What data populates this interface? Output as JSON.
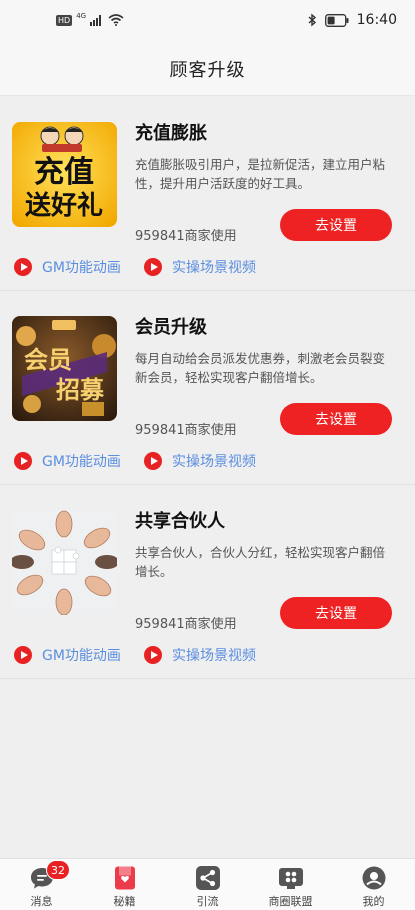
{
  "status_bar": {
    "hd": "HD",
    "network": "4G",
    "time": "16:40"
  },
  "header": {
    "title": "顾客升级"
  },
  "cards": [
    {
      "title": "充值膨胀",
      "description": "充值膨胀吸引用户，是拉新促活，建立用户粘性，提升用户活跃度的好工具。",
      "usage": "959841商家使用",
      "button": "去设置",
      "gm_link": "GM功能动画",
      "scene_link": "实操场景视频",
      "thumb_text_line1": "充值",
      "thumb_text_line2": "送好礼"
    },
    {
      "title": "会员升级",
      "description": "每月自动给会员派发优惠券，刺激老会员裂变新会员，轻松实现客户翻倍增长。",
      "usage": "959841商家使用",
      "button": "去设置",
      "gm_link": "GM功能动画",
      "scene_link": "实操场景视频",
      "thumb_text_line1": "会员",
      "thumb_text_line2": "招募"
    },
    {
      "title": "共享合伙人",
      "description": "共享合伙人，合伙人分红，轻松实现客户翻倍增长。",
      "usage": "959841商家使用",
      "button": "去设置",
      "gm_link": "GM功能动画",
      "scene_link": "实操场景视频"
    }
  ],
  "tab_bar": {
    "items": [
      {
        "label": "消息",
        "icon": "message-icon",
        "badge": "32"
      },
      {
        "label": "秘籍",
        "icon": "book-icon"
      },
      {
        "label": "引流",
        "icon": "share-icon"
      },
      {
        "label": "商圈联盟",
        "icon": "alliance-icon"
      },
      {
        "label": "我的",
        "icon": "profile-icon"
      }
    ]
  },
  "colors": {
    "accent_red": "#ee2222",
    "link_blue": "#5a8ee0",
    "background": "#efefef"
  }
}
